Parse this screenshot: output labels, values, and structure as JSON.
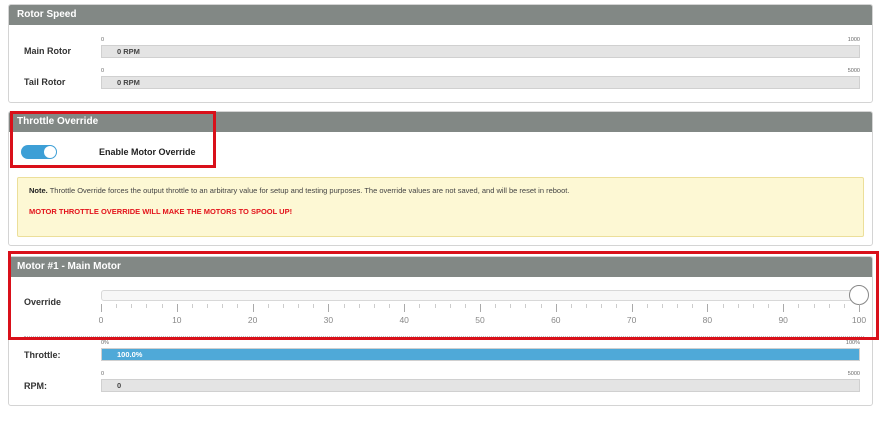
{
  "rotor_speed": {
    "title": "Rotor Speed",
    "main_rotor": {
      "label": "Main Rotor",
      "min": "0",
      "max": "1000",
      "value_text": "0 RPM",
      "fraction": 0
    },
    "tail_rotor": {
      "label": "Tail Rotor",
      "min": "0",
      "max": "5000",
      "value_text": "0 RPM",
      "fraction": 0
    }
  },
  "throttle_override": {
    "title": "Throttle Override",
    "toggle_label": "Enable Motor Override",
    "toggle_on": true,
    "note_bold": "Note.",
    "note_text": " Throttle Override forces the output throttle to an arbitrary value for setup and testing purposes. The override values are not saved, and will be reset in reboot.",
    "warning": "MOTOR THROTTLE OVERRIDE WILL MAKE THE MOTORS TO SPOOL UP!"
  },
  "motor1": {
    "title": "Motor #1 - Main Motor",
    "override_label": "Override",
    "override_value": 100,
    "tick_labels": [
      "0",
      "10",
      "20",
      "30",
      "40",
      "50",
      "60",
      "70",
      "80",
      "90",
      "100"
    ],
    "throttle": {
      "label": "Throttle:",
      "min": "0%",
      "max": "100%",
      "value_text": "100.0%",
      "fraction": 1.0
    },
    "rpm": {
      "label": "RPM:",
      "min": "0",
      "max": "5000",
      "value_text": "0",
      "fraction": 0
    }
  },
  "colors": {
    "accent": "#4fa9d8",
    "header": "#828885",
    "warning": "#e3131b",
    "highlight_box": "#d9101a"
  }
}
